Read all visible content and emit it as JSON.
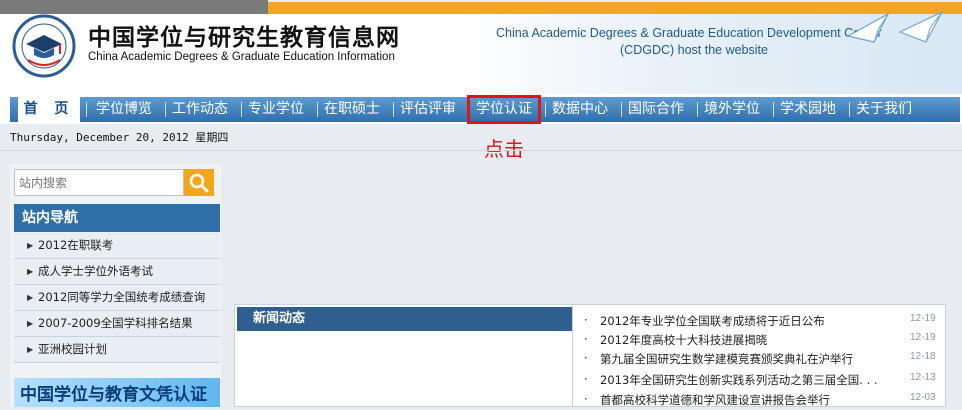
{
  "site": {
    "title_cn": "中国学位与研究生教育信息网",
    "title_en": "China Academic Degrees & Graduate Education Information",
    "host_line1": "China Academic Degrees & Graduate Education Development Center",
    "host_line2": "(CDGDC) host the website"
  },
  "colors": {
    "accent": "#f2a623",
    "nav_blue": "#2f6fae",
    "highlight_red": "#e1141b"
  },
  "nav": {
    "home": "首 页",
    "items": [
      "学位博览",
      "工作动态",
      "专业学位",
      "在职硕士",
      "评估评审",
      "学位认证",
      "数据中心",
      "国际合作",
      "境外学位",
      "学术园地",
      "关于我们"
    ]
  },
  "annotation": {
    "click_label": "点击"
  },
  "date": "Thursday, December 20, 2012 星期四",
  "sidebar": {
    "search_placeholder": "站内搜索",
    "search_icon": "search-icon",
    "nav_title": "站内导航",
    "items": [
      "2012在职联考",
      "成人学士学位外语考试",
      "2012同等学力全国统考成绩查询",
      "2007-2009全国学科排名结果",
      "亚洲校园计划"
    ],
    "banner": "中国学位与教育文凭认证"
  },
  "news": {
    "title": "新闻动态",
    "items": [
      {
        "text": "2012年专业学位全国联考成绩将于近日公布",
        "date": "12-19"
      },
      {
        "text": "2012年度高校十大科技进展揭晓",
        "date": "12-19"
      },
      {
        "text": "第九届全国研究生数学建模竞赛颁奖典礼在沪举行",
        "date": "12-18"
      },
      {
        "text": "2013年全国研究生创新实践系列活动之第三届全国. . .",
        "date": "12-13"
      },
      {
        "text": "首都高校科学道德和学风建设宣讲报告会举行",
        "date": "12-03"
      }
    ]
  }
}
